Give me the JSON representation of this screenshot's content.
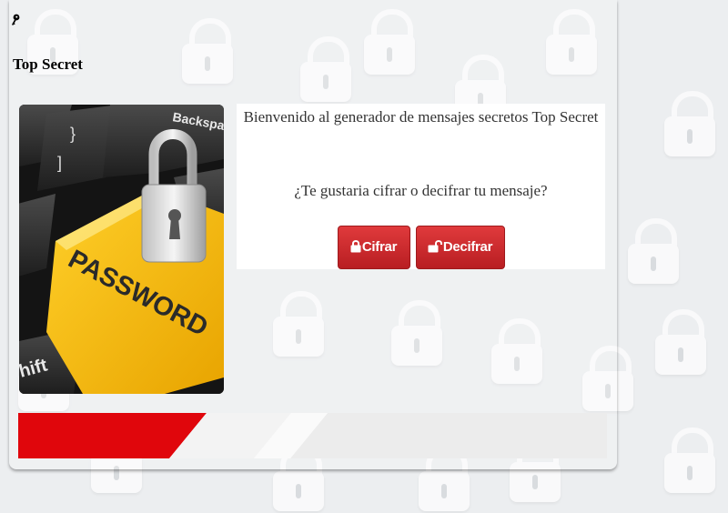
{
  "header": {
    "title": "Top Secret",
    "key_icon": "key-icon"
  },
  "hero": {
    "text_password": "PASSWORD",
    "text_backspace": "Backspa",
    "text_shift": "hift",
    "text_key_bracket1": "}",
    "text_key_bracket2": "]",
    "icon": "padlock-icon"
  },
  "card": {
    "welcome": "Bienvenido al generador de mensajes secretos Top Secret",
    "question": "¿Te gustaria cifrar o decifrar tu mensaje?",
    "cifrar_label": "Cifrar",
    "decifrar_label": "Decifrar"
  },
  "colors": {
    "accent": "#d01f22",
    "banner_red": "#e0060c",
    "background": "#eceef0"
  }
}
